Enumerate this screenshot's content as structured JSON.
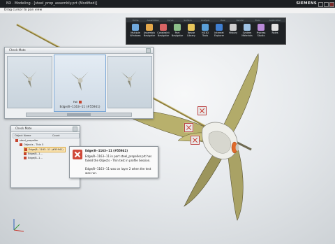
{
  "window": {
    "title": "NX · Modeling · [steel_prop_assembly.prt (Modified)]",
    "brand": "SIEMENS"
  },
  "hint": "Drag cursor to pan view",
  "ribbon": {
    "tabs": [
      "Home",
      "Assemblies",
      "Curve",
      "Surface",
      "Analysis",
      "View",
      "Render",
      "Tools",
      "Application"
    ],
    "tools": [
      {
        "label": "Multiple Windows",
        "icon": "windows-icon",
        "color": "#6fa8dc"
      },
      {
        "label": "Assembly Navigator",
        "icon": "assembly-icon",
        "color": "#e4a84a"
      },
      {
        "label": "Constraint Navigator",
        "icon": "constraint-icon",
        "color": "#d86464"
      },
      {
        "label": "Part Navigator",
        "icon": "part-icon",
        "color": "#8cc08a"
      },
      {
        "label": "Reuse Library",
        "icon": "library-icon",
        "color": "#e7c65a"
      },
      {
        "label": "HD3D Tools",
        "icon": "hd3d-icon",
        "color": "#5aa0d8"
      },
      {
        "label": "Internet Explorer",
        "icon": "browser-icon",
        "color": "#3f7fd1"
      },
      {
        "label": "History",
        "icon": "history-icon",
        "color": "#cfcfcf"
      },
      {
        "label": "System Materials",
        "icon": "materials-icon",
        "color": "#9fc4e6"
      },
      {
        "label": "Process Studio",
        "icon": "process-icon",
        "color": "#b98ad8"
      },
      {
        "label": "Roles",
        "icon": "roles-icon",
        "color": "#e3e3e3"
      }
    ]
  },
  "check_mate": {
    "title": "Check-Mate",
    "selected_caption": "Edge/8--1163--11 (#55941)",
    "status_left": "Fail"
  },
  "check_tree": {
    "title": "Check Mate",
    "columns": [
      "Object Name",
      "Count"
    ],
    "rows": [
      {
        "label": "steel_propeller",
        "value": ""
      },
      {
        "label": "Objects - Thin",
        "value": "5"
      },
      {
        "label": "Edge/8--1163--11 (#55941)",
        "value": ""
      },
      {
        "label": "Edge/8--1...",
        "value": ""
      },
      {
        "label": "Edge/8--1...",
        "value": ""
      }
    ]
  },
  "tooltip": {
    "title": "Edge/8--1163--11 (#55941)",
    "line1": "Edge/8--1163--11 in part steel_propeller.prt has failed the Objects - Thin test in profile Session.",
    "line2": "Edge/8--1163--11 was on layer 2 when the test was run."
  },
  "colors": {
    "accent": "#c8342a",
    "ribbon": "#1f2225"
  }
}
